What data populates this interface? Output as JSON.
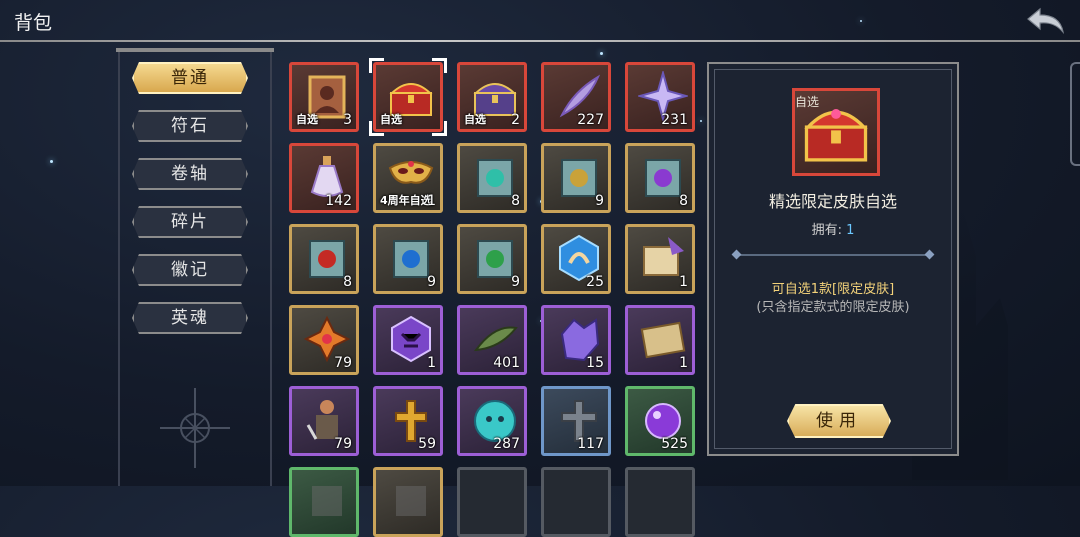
{
  "header": {
    "title": "背包"
  },
  "tabs": [
    {
      "label": "普通",
      "active": true
    },
    {
      "label": "符石",
      "active": false
    },
    {
      "label": "卷轴",
      "active": false
    },
    {
      "label": "碎片",
      "active": false
    },
    {
      "label": "徽记",
      "active": false
    },
    {
      "label": "英魂",
      "active": false
    }
  ],
  "items": [
    {
      "icon": "portrait-frame-icon",
      "rarity": "red",
      "count": "3",
      "tag": "自选"
    },
    {
      "icon": "red-treasure-chest-icon",
      "rarity": "red",
      "count": "",
      "tag": "自选",
      "selected": true
    },
    {
      "icon": "purple-treasure-chest-icon",
      "rarity": "red",
      "count": "2",
      "tag": "自选"
    },
    {
      "icon": "purple-feather-icon",
      "rarity": "red",
      "count": "227",
      "tag": ""
    },
    {
      "icon": "star-crystal-icon",
      "rarity": "red",
      "count": "231",
      "tag": ""
    },
    {
      "icon": "potion-bottle-icon",
      "rarity": "red",
      "count": "142",
      "tag": ""
    },
    {
      "icon": "golden-mask-icon",
      "rarity": "gold",
      "count": "1",
      "tag": "4周年自选"
    },
    {
      "icon": "teal-rune-scroll-icon",
      "rarity": "gold",
      "count": "8",
      "tag": ""
    },
    {
      "icon": "gold-rune-scroll-icon",
      "rarity": "gold",
      "count": "9",
      "tag": ""
    },
    {
      "icon": "purple-rune-scroll-icon",
      "rarity": "gold",
      "count": "8",
      "tag": ""
    },
    {
      "icon": "fire-rune-scroll-icon",
      "rarity": "gold",
      "count": "8",
      "tag": ""
    },
    {
      "icon": "water-rune-scroll-icon",
      "rarity": "gold",
      "count": "9",
      "tag": ""
    },
    {
      "icon": "nature-rune-scroll-icon",
      "rarity": "gold",
      "count": "9",
      "tag": ""
    },
    {
      "icon": "blue-crest-icon",
      "rarity": "gold",
      "count": "25",
      "tag": ""
    },
    {
      "icon": "quill-scroll-icon",
      "rarity": "gold",
      "count": "1",
      "tag": ""
    },
    {
      "icon": "orange-cross-emblem-icon",
      "rarity": "gold",
      "count": "79",
      "tag": ""
    },
    {
      "icon": "demon-crest-icon",
      "rarity": "purple",
      "count": "1",
      "tag": ""
    },
    {
      "icon": "green-leaf-icon",
      "rarity": "purple",
      "count": "401",
      "tag": ""
    },
    {
      "icon": "purple-crystal-icon",
      "rarity": "purple",
      "count": "15",
      "tag": ""
    },
    {
      "icon": "old-map-scroll-icon",
      "rarity": "purple",
      "count": "1",
      "tag": ""
    },
    {
      "icon": "warrior-figure-icon",
      "rarity": "purple",
      "count": "79",
      "tag": ""
    },
    {
      "icon": "golden-cross-icon",
      "rarity": "purple",
      "count": "59",
      "tag": ""
    },
    {
      "icon": "teal-skull-coin-icon",
      "rarity": "purple",
      "count": "287",
      "tag": ""
    },
    {
      "icon": "stone-cross-icon",
      "rarity": "blue",
      "count": "117",
      "tag": ""
    },
    {
      "icon": "purple-orb-icon",
      "rarity": "green",
      "count": "525",
      "tag": ""
    },
    {
      "icon": "partial-item-icon",
      "rarity": "green",
      "count": "",
      "tag": ""
    },
    {
      "icon": "partial-item-icon",
      "rarity": "gold",
      "count": "",
      "tag": ""
    },
    {
      "icon": "empty-slot",
      "rarity": "gray",
      "count": "",
      "tag": ""
    },
    {
      "icon": "empty-slot",
      "rarity": "gray",
      "count": "",
      "tag": ""
    },
    {
      "icon": "empty-slot",
      "rarity": "gray",
      "count": "",
      "tag": ""
    }
  ],
  "detail": {
    "icon": "red-treasure-chest-icon",
    "icon_tag": "自选",
    "name": "精选限定皮肤自选",
    "owned_label": "拥有:",
    "owned_count": "1",
    "desc_primary": "可自选1款[限定皮肤]",
    "desc_secondary": "(只含指定款式的限定皮肤)",
    "use_label": "使用"
  },
  "colors": {
    "red": "#d8473a",
    "gold": "#c9a35a",
    "purple": "#9d5fd6",
    "blue": "#6f97c9",
    "green": "#5fb86b",
    "gray": "#555a62",
    "accent_text": "#f3d27a",
    "owned_count": "#6cc8ff"
  }
}
